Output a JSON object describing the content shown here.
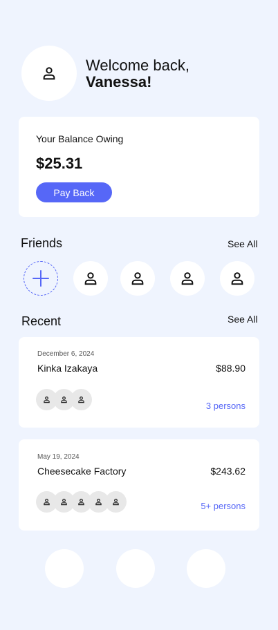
{
  "header": {
    "greeting_line1": "Welcome back,",
    "greeting_name": "Vanessa!",
    "avatar_icon": "user-icon"
  },
  "balance": {
    "label": "Your Balance Owing",
    "amount": "$25.31",
    "button_label": "Pay Back"
  },
  "friends": {
    "title": "Friends",
    "see_all": "See All",
    "add_icon": "plus-icon",
    "count": 4
  },
  "recent": {
    "title": "Recent",
    "see_all": "See All",
    "transactions": [
      {
        "date": "December 6, 2024",
        "name": "Kinka Izakaya",
        "amount": "$88.90",
        "persons": "3 persons",
        "avatar_count": 3
      },
      {
        "date": "May 19, 2024",
        "name": "Cheesecake Factory",
        "amount": "$243.62",
        "persons": "5+ persons",
        "avatar_count": 5
      }
    ]
  },
  "colors": {
    "background": "#eff4fe",
    "accent": "#5667f7",
    "card": "#ffffff"
  }
}
